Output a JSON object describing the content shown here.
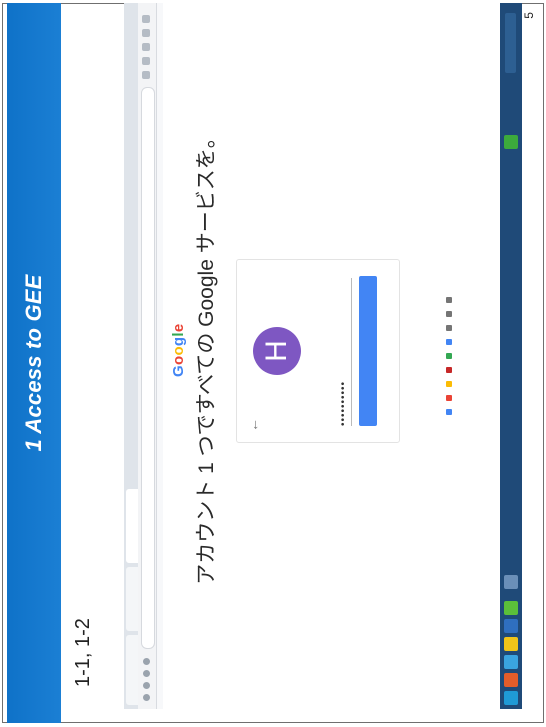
{
  "slide": {
    "title": "1 Access to GEE",
    "subtitle": "1-1, 1-2",
    "page_number": "5"
  },
  "browser": {
    "tabs": [],
    "login": {
      "logo_letters": [
        {
          "ch": "G",
          "color": "#4285f4"
        },
        {
          "ch": "o",
          "color": "#ea4335"
        },
        {
          "ch": "o",
          "color": "#fbbc05"
        },
        {
          "ch": "g",
          "color": "#4285f4"
        },
        {
          "ch": "l",
          "color": "#34a853"
        },
        {
          "ch": "e",
          "color": "#ea4335"
        }
      ],
      "headline": "アカウント 1 つですべての Google サービスを。",
      "avatar_letter": "H",
      "password_mask": "••••••••••"
    }
  },
  "colors": {
    "title_bar": "#1272c9",
    "avatar": "#7e57c2",
    "next_button": "#4285f4",
    "taskbar": "#1f4a78"
  }
}
